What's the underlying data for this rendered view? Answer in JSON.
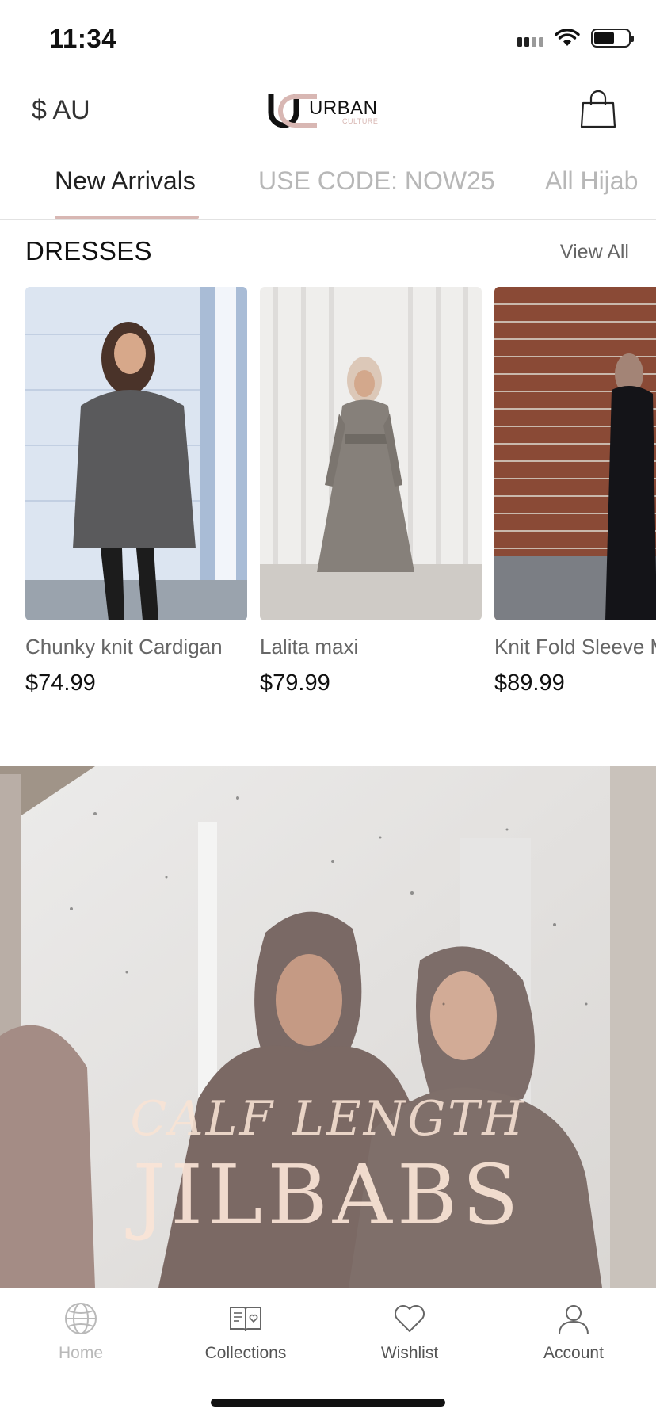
{
  "status_bar": {
    "time": "11:34"
  },
  "header": {
    "currency": "$ AU",
    "logo_text": "URBAN",
    "logo_subtext": "CULTURE",
    "cart_icon": "shopping-bag-icon"
  },
  "tabs": [
    {
      "label": "New Arrivals",
      "active": true
    },
    {
      "label": "USE CODE: NOW25",
      "active": false
    },
    {
      "label": "All Hijab",
      "active": false
    }
  ],
  "section": {
    "title": "DRESSES",
    "view_all": "View All"
  },
  "products": [
    {
      "name": "Chunky knit Cardigan",
      "price": "$74.99"
    },
    {
      "name": "Lalita maxi",
      "price": "$79.99"
    },
    {
      "name": "Knit Fold Sleeve Maxi",
      "price": "$89.99"
    }
  ],
  "banner": {
    "line1": "CALF LENGTH",
    "line2": "JILBABS"
  },
  "bottom_nav": [
    {
      "label": "Home",
      "icon": "globe-icon",
      "active": true
    },
    {
      "label": "Collections",
      "icon": "book-icon",
      "active": false
    },
    {
      "label": "Wishlist",
      "icon": "heart-icon",
      "active": false
    },
    {
      "label": "Account",
      "icon": "user-icon",
      "active": false
    }
  ],
  "colors": {
    "accent": "#d8b7b3",
    "inactive_tab": "#b7b7b7",
    "banner_text": "#f8e2d4"
  }
}
